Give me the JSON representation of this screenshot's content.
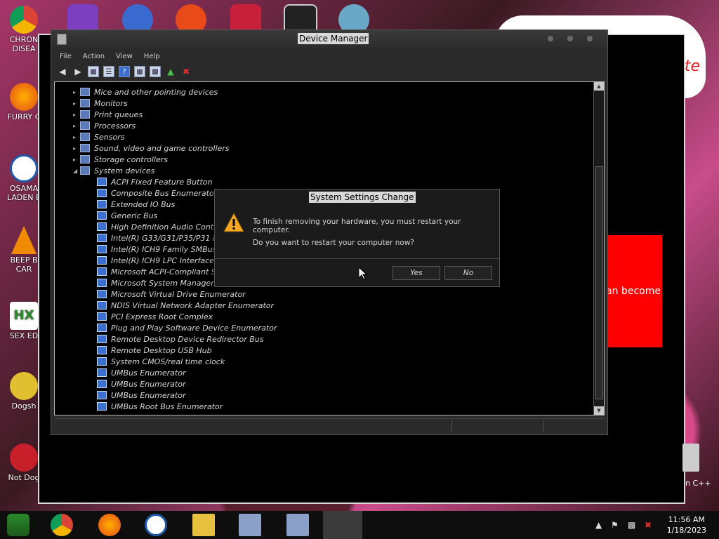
{
  "desktop": {
    "icons": [
      {
        "label": "CHRON DISEA"
      },
      {
        "label": "FURRY C"
      },
      {
        "label": "OSAMA LADEN E"
      },
      {
        "label": "BEEP B CAR"
      },
      {
        "label": "SEX ED"
      },
      {
        "label": "Dogsh"
      },
      {
        "label": "Not Dog"
      }
    ],
    "right_labels": [
      "n C++"
    ],
    "bg_red_text": "an become",
    "bg_cloud_text": "te"
  },
  "device_manager": {
    "title": "Device Manager",
    "menu": [
      "File",
      "Action",
      "View",
      "Help"
    ],
    "tree": [
      {
        "label": "Mice and other pointing devices",
        "level": 0,
        "expanded": false
      },
      {
        "label": "Monitors",
        "level": 0,
        "expanded": false
      },
      {
        "label": "Print queues",
        "level": 0,
        "expanded": false
      },
      {
        "label": "Processors",
        "level": 0,
        "expanded": false
      },
      {
        "label": "Sensors",
        "level": 0,
        "expanded": false
      },
      {
        "label": "Sound, video and game controllers",
        "level": 0,
        "expanded": false
      },
      {
        "label": "Storage controllers",
        "level": 0,
        "expanded": false
      },
      {
        "label": "System devices",
        "level": 0,
        "expanded": true
      },
      {
        "label": "ACPI Fixed Feature Button",
        "level": 1
      },
      {
        "label": "Composite Bus Enumerator",
        "level": 1
      },
      {
        "label": "Extended IO Bus",
        "level": 1
      },
      {
        "label": "Generic Bus",
        "level": 1
      },
      {
        "label": "High Definition Audio Control",
        "level": 1
      },
      {
        "label": "Intel(R) G33/G31/P35/P31 Exp",
        "level": 1
      },
      {
        "label": "Intel(R) ICH9 Family SMBus C",
        "level": 1
      },
      {
        "label": "Intel(R) ICH9 LPC Interface Co",
        "level": 1
      },
      {
        "label": "Microsoft ACPI-Compliant Sys",
        "level": 1
      },
      {
        "label": "Microsoft System Manageme",
        "level": 1
      },
      {
        "label": "Microsoft Virtual Drive Enumerator",
        "level": 1
      },
      {
        "label": "NDIS Virtual Network Adapter Enumerator",
        "level": 1
      },
      {
        "label": "PCI Express Root Complex",
        "level": 1
      },
      {
        "label": "Plug and Play Software Device Enumerator",
        "level": 1
      },
      {
        "label": "Remote Desktop Device Redirector Bus",
        "level": 1
      },
      {
        "label": "Remote Desktop USB Hub",
        "level": 1
      },
      {
        "label": "System CMOS/real time clock",
        "level": 1
      },
      {
        "label": "UMBus Enumerator",
        "level": 1
      },
      {
        "label": "UMBus Enumerator",
        "level": 1
      },
      {
        "label": "UMBus Enumerator",
        "level": 1
      },
      {
        "label": "UMBus Root Bus Enumerator",
        "level": 1
      }
    ]
  },
  "dialog": {
    "title": "System Settings Change",
    "message1": "To finish removing your hardware, you must restart your computer.",
    "message2": "Do you want to restart your computer now?",
    "yes_label": "Yes",
    "no_label": "No"
  },
  "taskbar": {
    "time": "11:56 AM",
    "date": "1/18/2023"
  },
  "colors": {
    "dialog_bg": "#1b1b1b",
    "tree_bg": "#000000",
    "warning": "#f5a623",
    "taskbar_bg": "#0e0e0e"
  }
}
